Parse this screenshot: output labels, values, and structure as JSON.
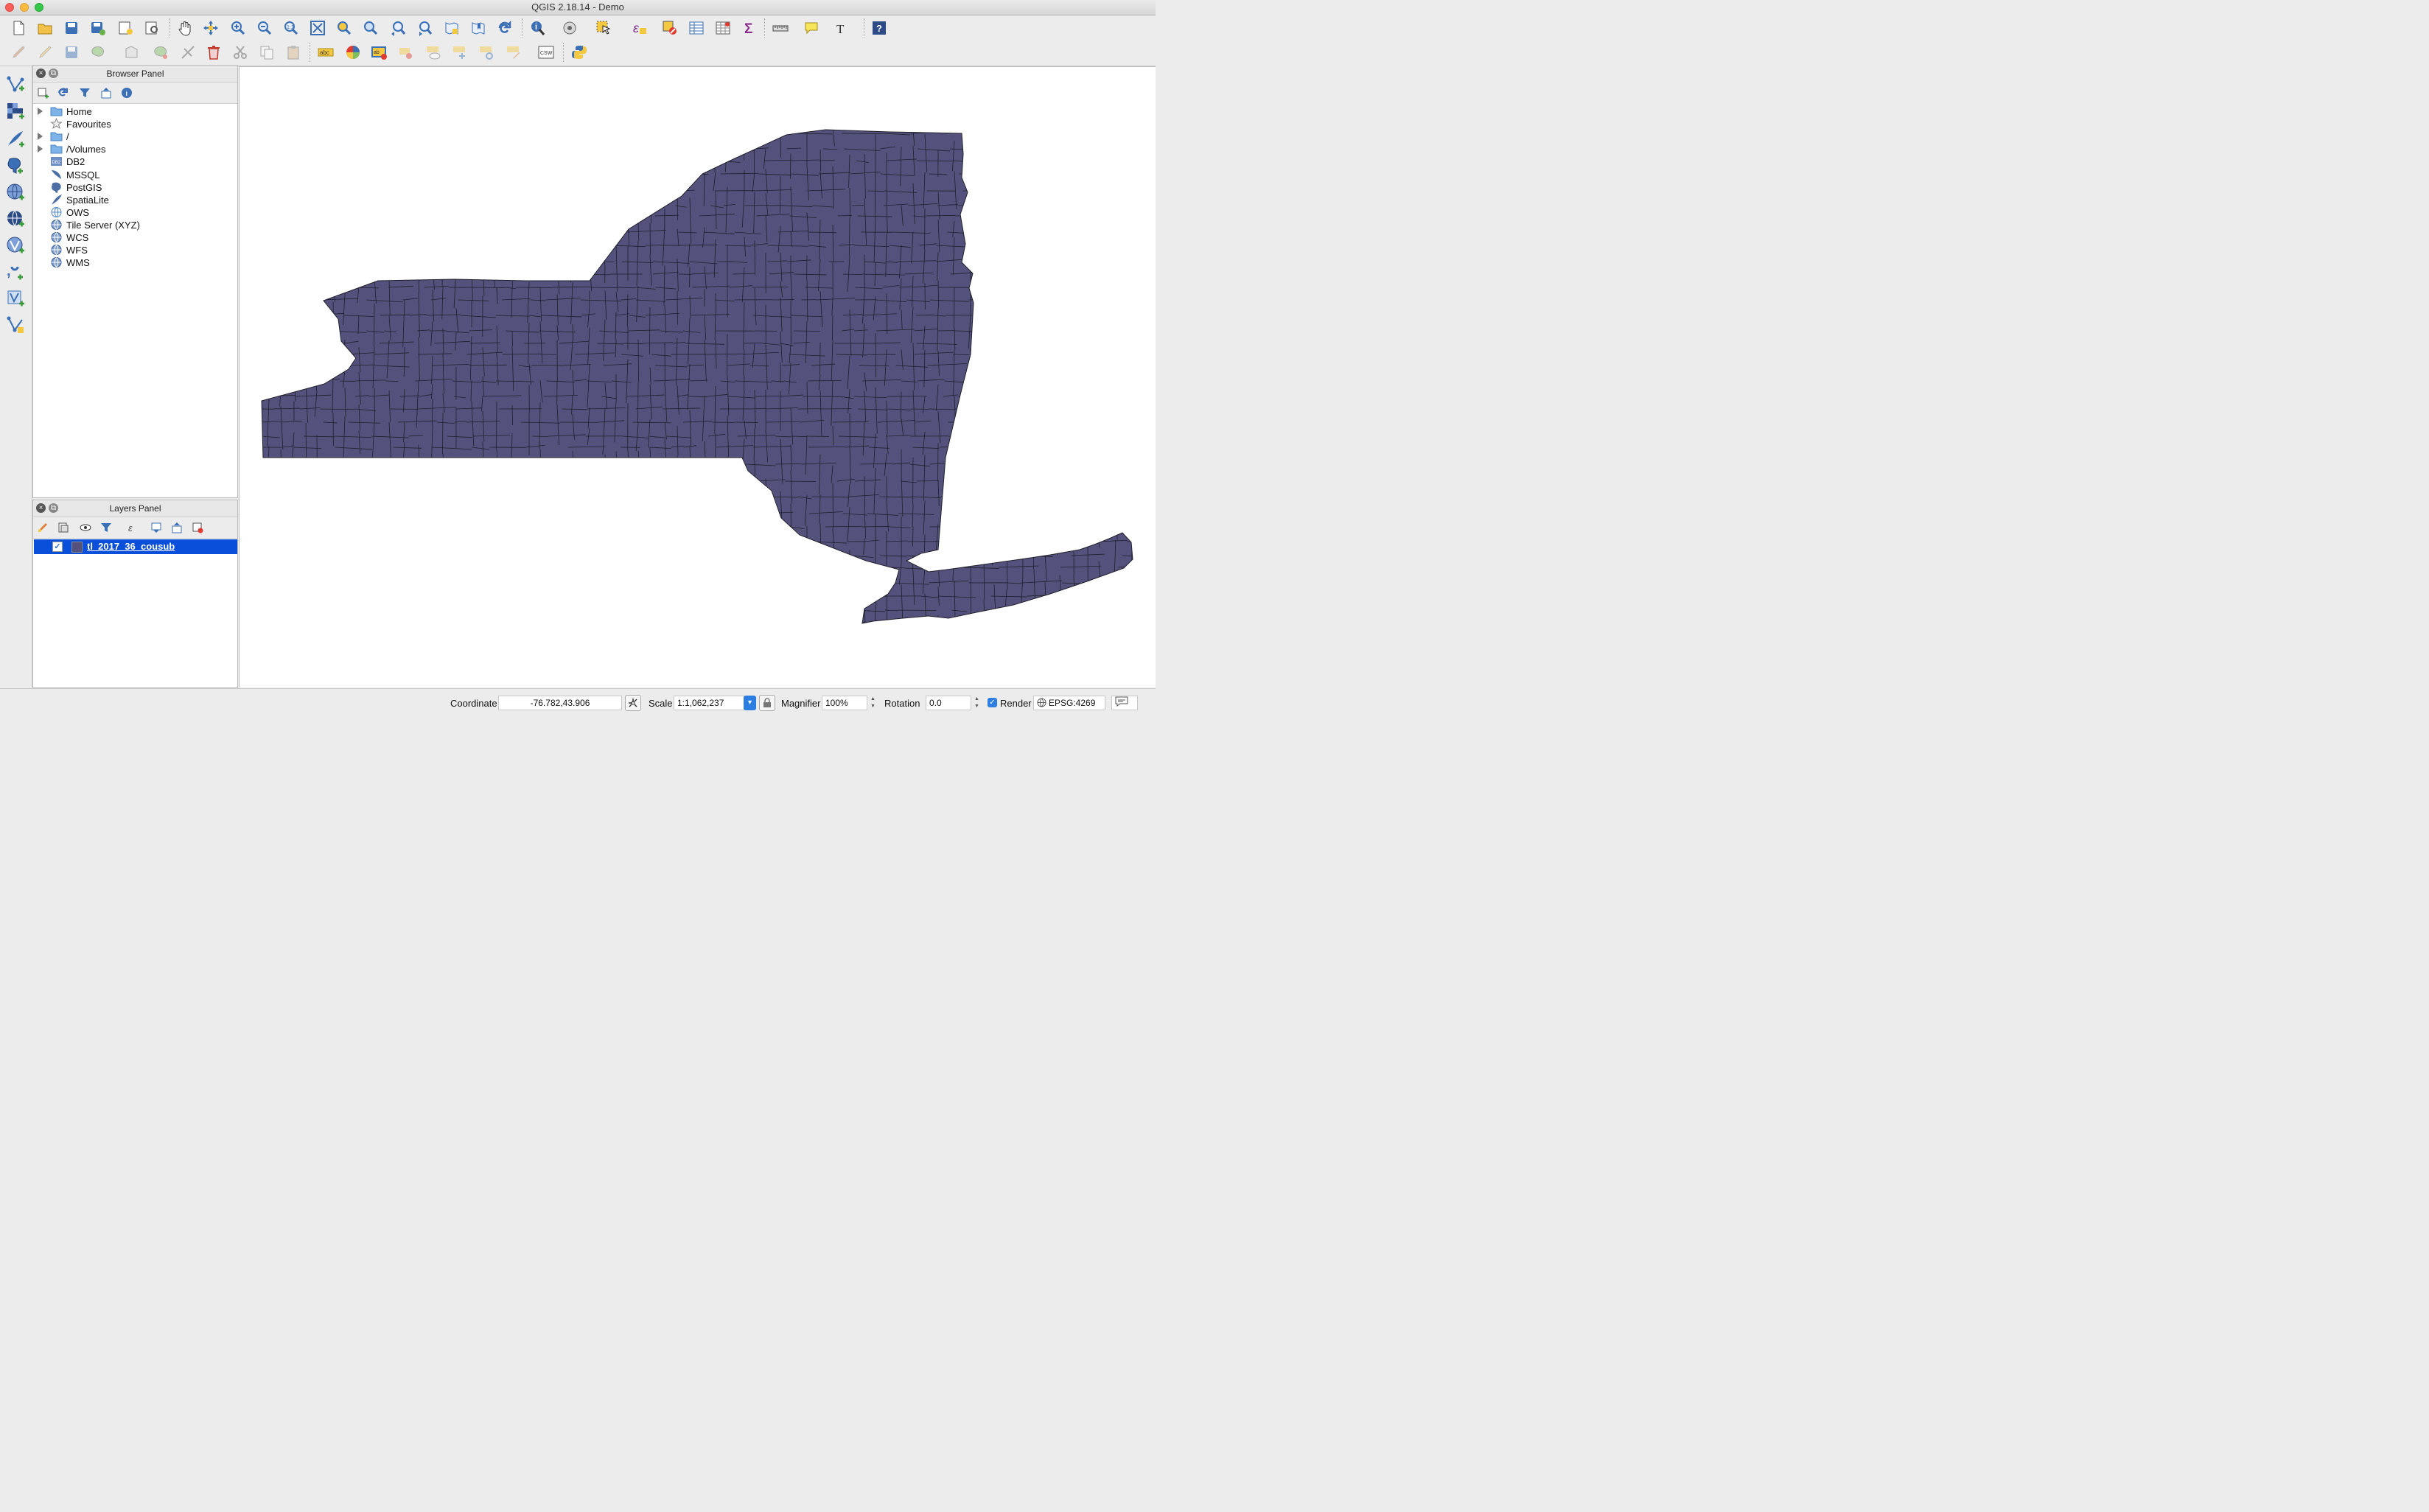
{
  "window": {
    "title": "QGIS 2.18.14 - Demo"
  },
  "toolbar_top": {
    "icons": [
      "new-project-icon",
      "open-project-icon",
      "save-project-icon",
      "save-as-icon",
      "new-print-composer-icon",
      "composer-manager-icon",
      "pan-icon",
      "pan-to-selection-icon",
      "zoom-in-icon",
      "zoom-out-icon",
      "zoom-native-icon",
      "zoom-full-icon",
      "zoom-to-selection-icon",
      "zoom-to-layer-icon",
      "zoom-last-icon",
      "zoom-next-icon",
      "new-map-view-icon",
      "new-bookmark-icon",
      "refresh-icon",
      "identify-icon",
      "measure-select-icon",
      "select-features-icon",
      "select-expression-icon",
      "deselect-icon",
      "attribute-table-icon",
      "field-calculator-icon",
      "statistics-icon",
      "measure-line-icon",
      "map-tips-icon",
      "text-annotation-icon",
      "help-icon"
    ]
  },
  "toolbar_edit": {
    "icons": [
      "current-edits-icon",
      "toggle-editing-icon",
      "save-edits-icon",
      "add-feature-icon",
      "move-feature-icon",
      "node-tool-icon",
      "digitize-icon",
      "delete-selected-icon",
      "cut-features-icon",
      "copy-features-icon",
      "paste-features-icon",
      "label-tool-icon",
      "diagram-icon",
      "highlight-label-icon",
      "pin-label-icon",
      "show-hide-label-icon",
      "move-label-icon",
      "rotate-label-icon",
      "change-label-icon",
      "csw-icon",
      "python-console-icon"
    ],
    "csw_label": "CSW",
    "abc_label": "abc"
  },
  "left_toolbar": {
    "icons": [
      "add-vector-layer-icon",
      "add-raster-layer-icon",
      "add-spatialite-layer-icon",
      "add-postgis-layer-icon",
      "add-wms-layer-icon",
      "add-wcs-layer-icon",
      "add-wfs-layer-icon",
      "add-delimited-text-icon",
      "add-virtual-layer-icon",
      "new-shapefile-icon"
    ]
  },
  "browser_panel": {
    "title": "Browser Panel",
    "items": [
      {
        "label": "Home",
        "icon": "folder-icon",
        "expandable": true
      },
      {
        "label": "Favourites",
        "icon": "star-icon",
        "expandable": false
      },
      {
        "label": "/",
        "icon": "folder-icon",
        "expandable": true
      },
      {
        "label": "/Volumes",
        "icon": "folder-icon",
        "expandable": true
      },
      {
        "label": "DB2",
        "icon": "db2-icon",
        "expandable": false
      },
      {
        "label": "MSSQL",
        "icon": "mssql-icon",
        "expandable": false
      },
      {
        "label": "PostGIS",
        "icon": "postgis-icon",
        "expandable": false
      },
      {
        "label": "SpatiaLite",
        "icon": "spatialite-icon",
        "expandable": false
      },
      {
        "label": "OWS",
        "icon": "ows-icon",
        "expandable": false
      },
      {
        "label": "Tile Server (XYZ)",
        "icon": "globe-icon",
        "expandable": false
      },
      {
        "label": "WCS",
        "icon": "globe-icon",
        "expandable": false
      },
      {
        "label": "WFS",
        "icon": "globe-icon",
        "expandable": false
      },
      {
        "label": "WMS",
        "icon": "globe-icon",
        "expandable": false
      }
    ]
  },
  "layers_panel": {
    "title": "Layers Panel",
    "layers": [
      {
        "name": "tl_2017_36_cousub",
        "visible": true,
        "fill_color": "#54527c"
      }
    ]
  },
  "map": {
    "fill_color": "#54527c",
    "stroke_color": "#1f1f2b",
    "background": "#ffffff"
  },
  "status": {
    "coordinate_label": "Coordinate",
    "coordinate_value": "-76.782,43.906",
    "scale_label": "Scale",
    "scale_value": "1:1,062,237",
    "magnifier_label": "Magnifier",
    "magnifier_value": "100%",
    "rotation_label": "Rotation",
    "rotation_value": "0.0",
    "render_label": "Render",
    "render_checked": true,
    "crs_label": "EPSG:4269"
  }
}
